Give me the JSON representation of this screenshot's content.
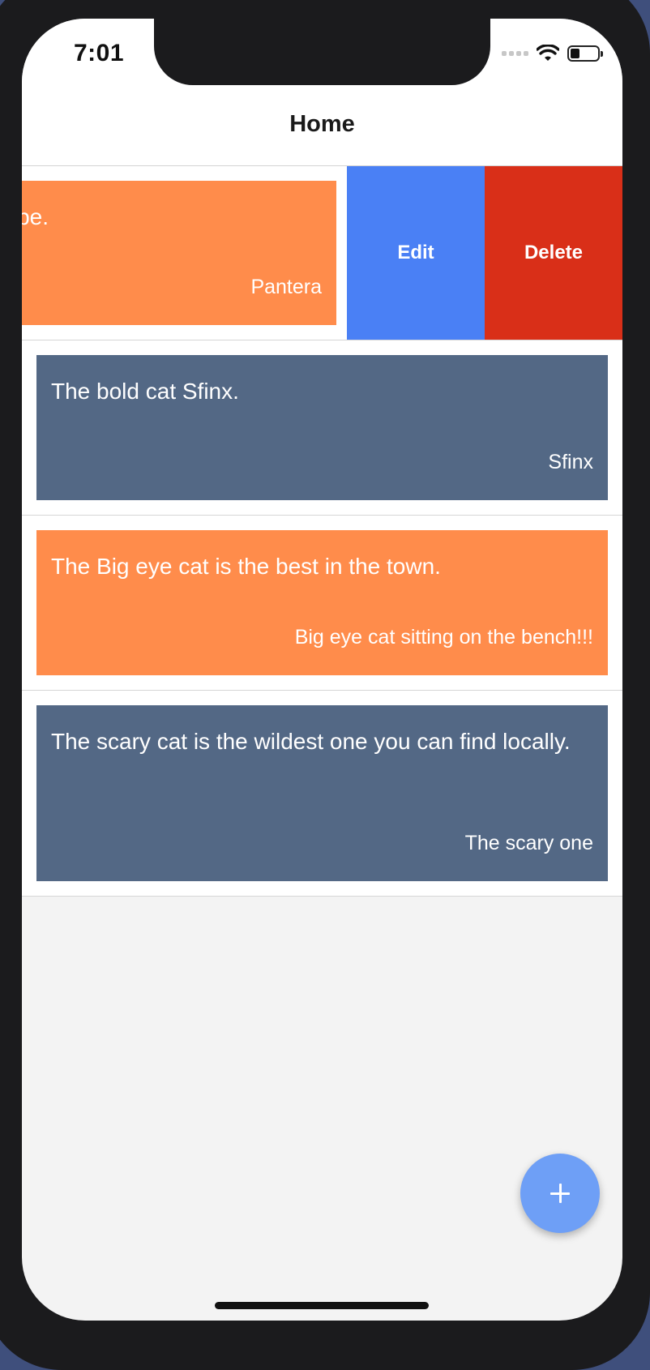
{
  "status_bar": {
    "time": "7:01",
    "battery_level": 0.35,
    "icons": [
      "cellular-signal-icon",
      "wifi-icon",
      "battery-icon"
    ]
  },
  "nav": {
    "title": "Home"
  },
  "colors": {
    "orange": "#ff8c4b",
    "slate": "#536885",
    "edit_blue": "#4a80f5",
    "delete_red": "#d92f18",
    "fab_blue": "#6e9ff6"
  },
  "cards": [
    {
      "text": "rope.",
      "author": "Pantera",
      "color": "orange",
      "swiped": true
    },
    {
      "text": "The bold cat Sfinx.",
      "author": "Sfinx",
      "color": "slate"
    },
    {
      "text": "The Big eye cat is the best in the town.",
      "author": "Big eye cat sitting on the bench!!!",
      "color": "orange"
    },
    {
      "text": "The scary cat is the wildest one you can find locally.",
      "author": "The scary one",
      "color": "slate"
    }
  ],
  "swipe_actions": {
    "edit_label": "Edit",
    "delete_label": "Delete"
  },
  "fab": {
    "icon": "plus-icon"
  }
}
